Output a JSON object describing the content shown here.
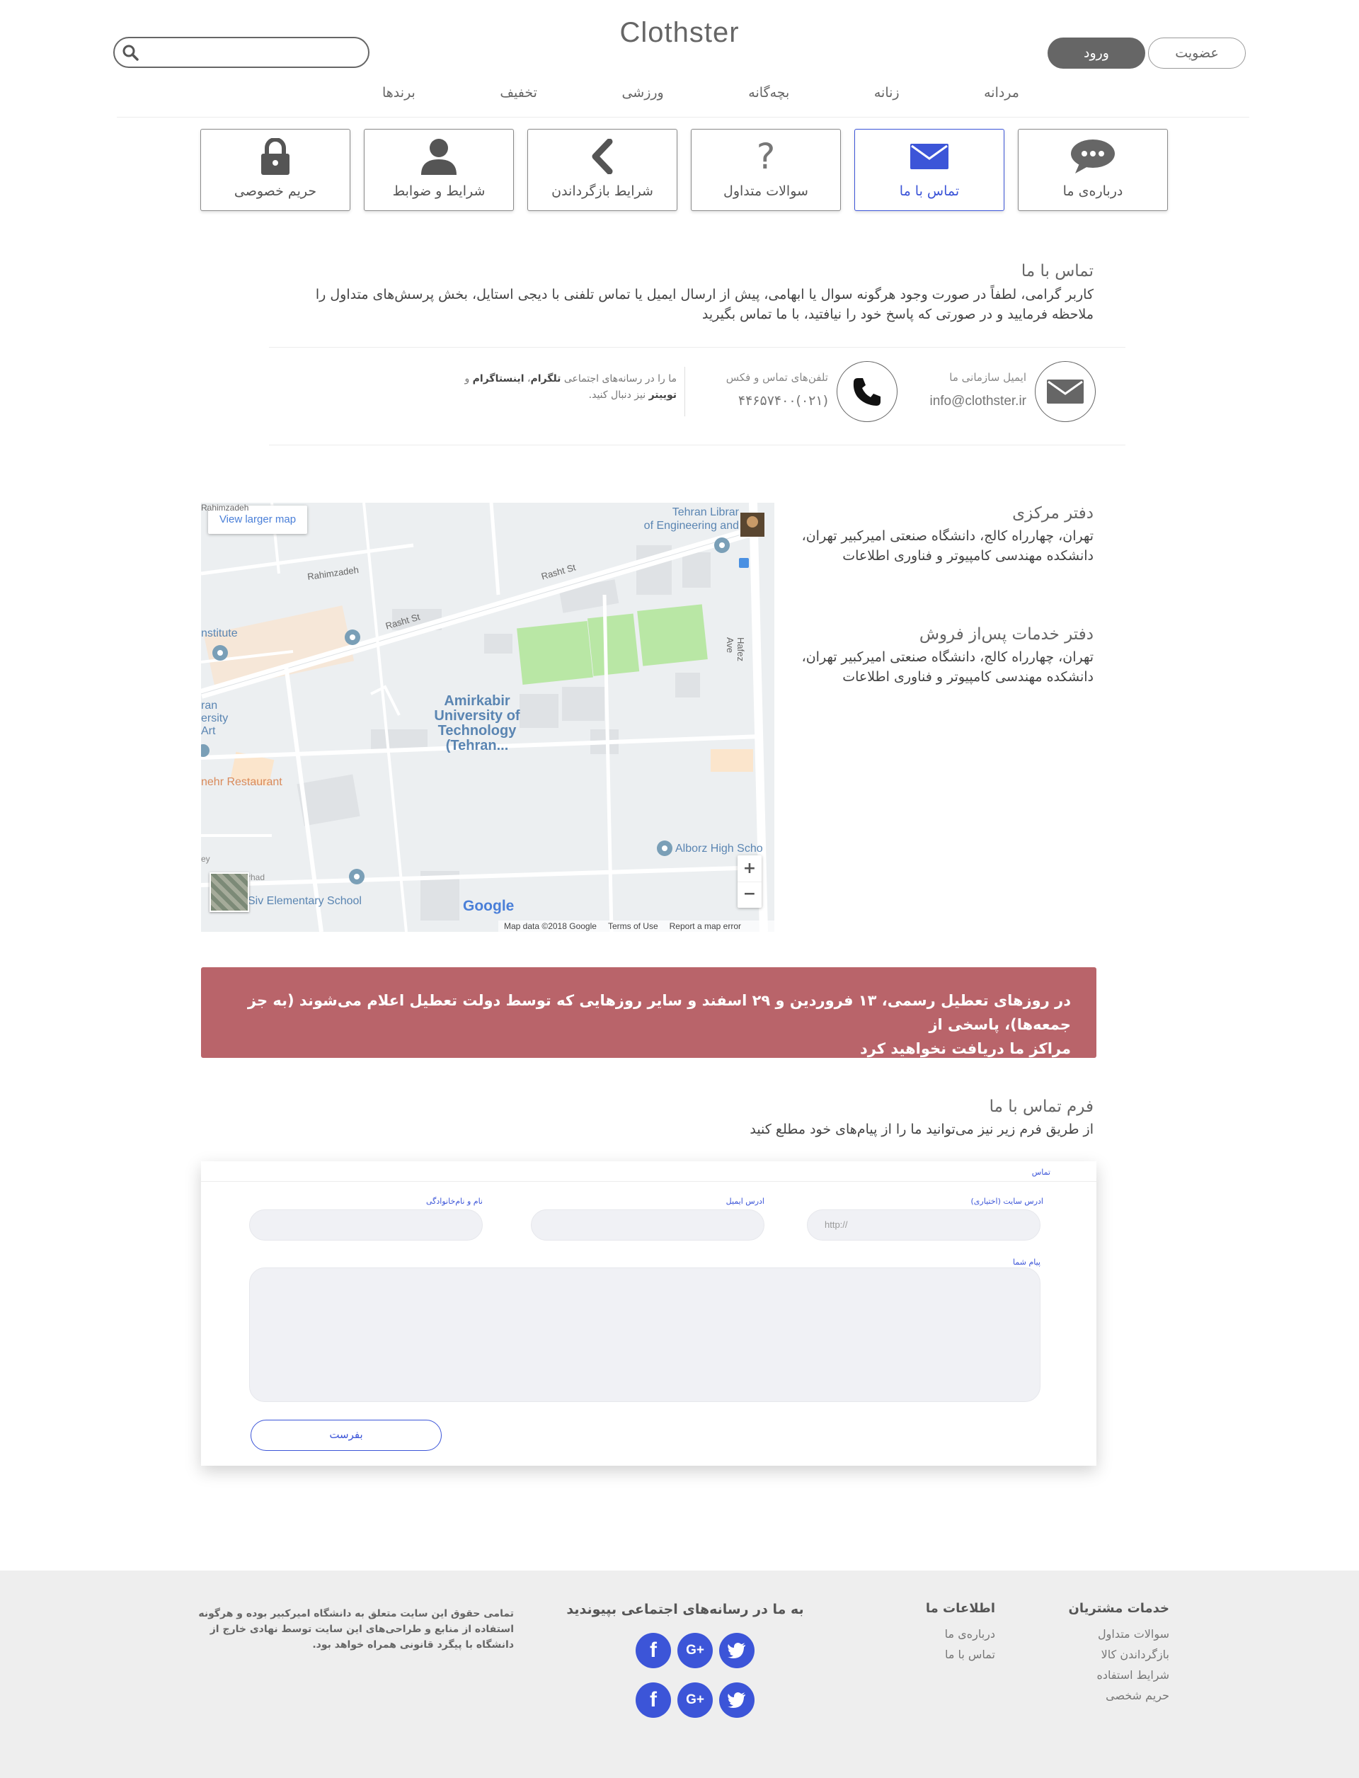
{
  "header": {
    "logo": "Clothster",
    "search_placeholder": "",
    "join_label": "عضویت",
    "login_label": "ورود",
    "nav": [
      "مردانه",
      "زنانه",
      "بچه‌گانه",
      "ورزشی",
      "تخفیف",
      "برندها"
    ]
  },
  "tabs": [
    {
      "label": "درباره‌ی ما",
      "icon": "chat-bubble-icon"
    },
    {
      "label": "تماس با ما",
      "icon": "envelope-icon"
    },
    {
      "label": "سوالات متداول",
      "icon": "question-mark-icon"
    },
    {
      "label": "شرایط بازگرداندن",
      "icon": "chevron-left-icon"
    },
    {
      "label": "شرایط و ضوابط",
      "icon": "user-icon"
    },
    {
      "label": "حریم خصوصی",
      "icon": "lock-icon"
    }
  ],
  "active_tab": "تماس با ما",
  "contact": {
    "title": "تماس با ما",
    "intro_line1": "کاربر گرامی، لطفاً در صورت وجود هرگونه سوال یا ابهامی، پیش از ارسال ایمیل یا تماس تلفنی با دیجی استایل، بخش پرسش‌های متداول را",
    "intro_line2": "ملاحظه فرمایید و در صورتی که پاسخ خود را نیافتید، با ما تماس بگیرید",
    "email_label": "ایمیل سازمانی ما",
    "email_value": "info@clothster.ir",
    "phone_label": "تلفن‌های تماس و فکس",
    "phone_value": "(۰۲۱)۴۴۶۵۷۴۰۰",
    "social_line1_a": "ما را در رسانه‌های اجتماعی ",
    "social_telegram": "تلگرام",
    "social_sep": "، ",
    "social_instagram": "اینستاگرام",
    "social_and": " و",
    "social_twitter": "توییتر",
    "social_tail": " نیز دنبال کنید."
  },
  "offices": [
    {
      "title": "دفتر مرکزی",
      "line1": "تهران، چهارراه کالج، دانشگاه صنعتی امیرکبیر تهران،",
      "line2": "دانشکده مهندسی کامپیوتر و فناوری اطلاعات"
    },
    {
      "title": "دفتر خدمات پس‌از فروش",
      "line1": "تهران، چهارراه کالج، دانشگاه صنعتی امیرکبیر تهران،",
      "line2": "دانشکده مهندسی کامپیوتر و فناوری اطلاعات"
    }
  ],
  "map": {
    "view_larger": "View larger map",
    "poi_center": [
      "Amirkabir",
      "University of",
      "Technology",
      "(Tehran..."
    ],
    "poi_library": [
      "Tehran Librar",
      "of Engineering and"
    ],
    "street_rasht1": "Rasht St",
    "street_rasht2": "Rasht St",
    "street_rahim1": "Rahimzadeh",
    "street_rahim2": "Rahimzadeh",
    "street_hafez": "Hafez Ave",
    "poi_institute": "nstitute",
    "poi_art": [
      "ran",
      "ersity",
      "Art"
    ],
    "poi_restaurant": "nehr Restaurant",
    "poi_alborz": "Alborz High Scho",
    "poi_school": "Siv Elementary School",
    "poi_rhad": "rhad",
    "poi_ey": "ey",
    "google": "Google",
    "map_data": "Map data ©2018 Google",
    "terms": "Terms of Use",
    "report": "Report a map error",
    "zoom_in": "+",
    "zoom_out": "−"
  },
  "alert": {
    "line1": "در روزهای تعطیل رسمی، ۱۳ فروردین و ۲۹ اسفند و سایر روزهایی که توسط دولت تعطیل اعلام می‌شوند (به جز جمعه‌ها)، پاسخی از",
    "line2": "مراکز ما دریافت نخواهید کرد"
  },
  "form": {
    "title": "فرم تماس با ما",
    "subtitle": "از طریق فرم زیر نیز می‌توانید ما را از پیام‌های خود مطلع کنید",
    "tab_label": "تماس",
    "website_label": "ادرس سایت (اختیاری)",
    "website_placeholder": "http://",
    "email_label": "ادرس ایمیل",
    "name_label": "نام و نام‌خانوادگی",
    "message_label": "پیام شما",
    "send_label": "بفرست"
  },
  "footer": {
    "customer_title": "خدمات مشتریان",
    "customer_links": [
      "سوالات متداول",
      "بازگرداندن کالا",
      "شرایط استفاده",
      "حریم شخصی"
    ],
    "info_title": "اطلاعات ما",
    "info_links": [
      "درباره‌ی ما",
      "تماس با ما"
    ],
    "social_title": "به ما در رسانه‌های اجتماعی بپیوندید",
    "social_icons": [
      "twitter-icon",
      "google-plus-icon",
      "facebook-icon"
    ],
    "copyright_line1": "تمامی حقوق این سایت متعلق به دانشگاه امیرکبیر بوده و هرگونه",
    "copyright_line2": "استفاده از منابع و طراحی‌های این سایت توسط نهادی خارج از",
    "copyright_line3": "دانشگاه با پیگرد قانونی همراه خواهد بود."
  },
  "colors": {
    "accent": "#3c55d8",
    "alert": "#b9646a",
    "dark_button": "#666666",
    "footer_bg": "#eeeeee"
  }
}
